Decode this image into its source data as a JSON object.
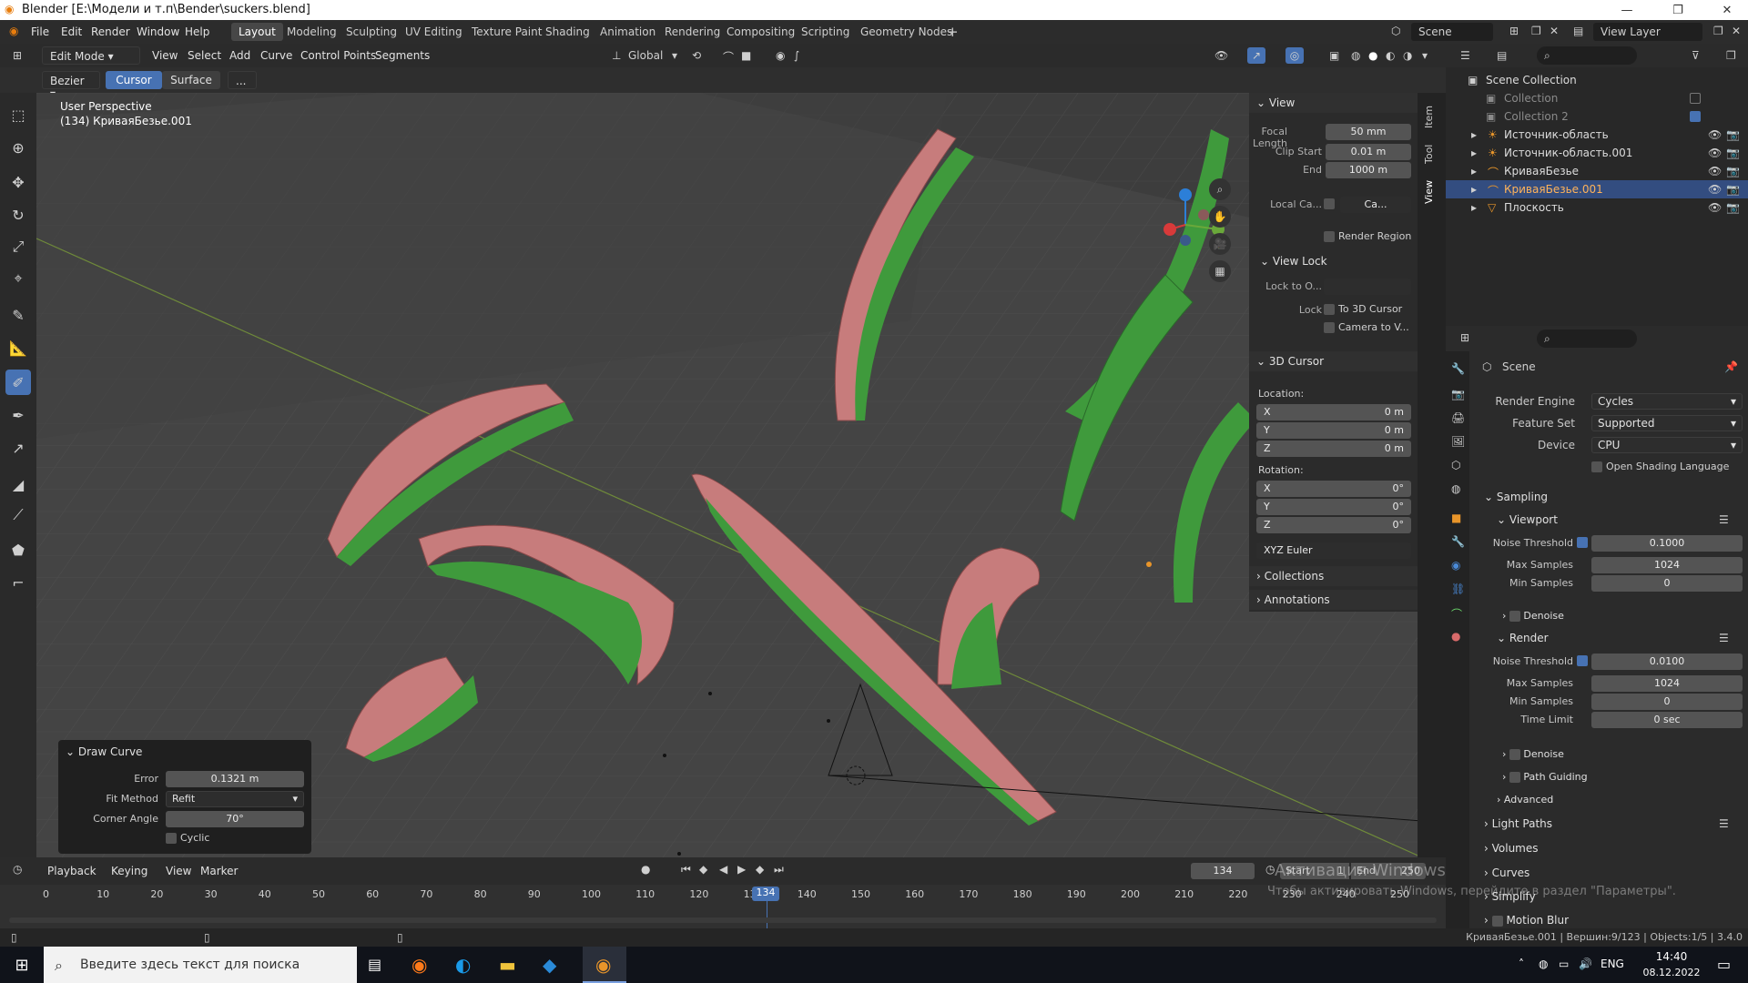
{
  "window": {
    "title": "Blender [E:\\Модели и т.п\\Bender\\suckers.blend]"
  },
  "menubar": {
    "items": [
      "File",
      "Edit",
      "Render",
      "Window",
      "Help"
    ]
  },
  "workspaces": [
    "Layout",
    "Modeling",
    "Sculpting",
    "UV Editing",
    "Texture Paint",
    "Shading",
    "Animation",
    "Rendering",
    "Compositing",
    "Scripting",
    "Geometry Nodes"
  ],
  "scene": {
    "name": "Scene",
    "view_layer": "View Layer"
  },
  "header": {
    "mode": "Edit Mode",
    "menus": [
      "View",
      "Select",
      "Add",
      "Curve",
      "Control Points",
      "Segments"
    ],
    "orientation": "Global"
  },
  "toolsettings": {
    "curve_type": "Bezier",
    "depth_cursor": "Cursor",
    "depth_surface": "Surface",
    "more": "..."
  },
  "viewport": {
    "perspective": "User Perspective",
    "object_info": "(134) КриваяБезье.001"
  },
  "npanel": {
    "tabs": [
      "Item",
      "Tool",
      "View"
    ],
    "view_header": "View",
    "focal_label": "Focal Length",
    "focal": "50 mm",
    "clip_start_label": "Clip Start",
    "clip_start": "0.01 m",
    "end_label": "End",
    "end": "1000 m",
    "local_camera_label": "Local Ca...",
    "local_camera_field": "Ca...",
    "render_region": "Render Region",
    "view_lock_header": "View Lock",
    "lock_to_label": "Lock to O...",
    "lock_label": "Lock",
    "to_3d_cursor": "To 3D Cursor",
    "camera_to_view": "Camera to V...",
    "cursor_header": "3D Cursor",
    "location_label": "Location:",
    "rotation_label": "Rotation:",
    "loc": [
      {
        "axis": "X",
        "value": "0 m"
      },
      {
        "axis": "Y",
        "value": "0 m"
      },
      {
        "axis": "Z",
        "value": "0 m"
      }
    ],
    "rot": [
      {
        "axis": "X",
        "value": "0°"
      },
      {
        "axis": "Y",
        "value": "0°"
      },
      {
        "axis": "Z",
        "value": "0°"
      }
    ],
    "rot_mode": "XYZ Euler",
    "collections": "Collections",
    "annotations": "Annotations"
  },
  "draw_curve": {
    "title": "Draw Curve",
    "error_label": "Error",
    "error": "0.1321 m",
    "fit_label": "Fit Method",
    "fit": "Refit",
    "corner_label": "Corner Angle",
    "corner": "70°",
    "cyclic": "Cyclic"
  },
  "outliner": {
    "root": "Scene Collection",
    "rows": [
      "Collection",
      "Collection 2",
      "Источник-область",
      "Источник-область.001",
      "КриваяБезье",
      "КриваяБезье.001",
      "Плоскость"
    ]
  },
  "properties": {
    "scene": "Scene",
    "render_engine_label": "Render Engine",
    "render_engine": "Cycles",
    "feature_set_label": "Feature Set",
    "feature_set": "Supported",
    "device_label": "Device",
    "device": "CPU",
    "osl": "Open Shading Language",
    "sampling": "Sampling",
    "viewport": "Viewport",
    "noise_label": "Noise Threshold",
    "vp_noise": "0.1000",
    "max_label": "Max Samples",
    "vp_max": "1024",
    "min_label": "Min Samples",
    "vp_min": "0",
    "denoise": "Denoise",
    "render": "Render",
    "r_noise": "0.0100",
    "r_max": "1024",
    "r_min": "0",
    "time_label": "Time Limit",
    "time": "0 sec",
    "path_guiding": "Path Guiding",
    "advanced": "Advanced",
    "light_paths": "Light Paths",
    "volumes": "Volumes",
    "curves": "Curves",
    "simplify": "Simplify",
    "motion_blur": "Motion Blur"
  },
  "timeline": {
    "menus": [
      "Playback",
      "Keying",
      "View",
      "Marker"
    ],
    "current": "134",
    "start_label": "Start",
    "start": "1",
    "end_label": "End",
    "end": "250",
    "ticks": [
      "0",
      "10",
      "20",
      "30",
      "40",
      "50",
      "60",
      "70",
      "80",
      "90",
      "100",
      "110",
      "120",
      "130",
      "140",
      "150",
      "160",
      "170",
      "180",
      "190",
      "200",
      "210",
      "220",
      "230",
      "240",
      "250"
    ]
  },
  "watermark": {
    "line1": "Активация Windows",
    "line2": "Чтобы активировать Windows, перейдите в раздел \"Параметры\"."
  },
  "status": {
    "text": "КриваяБезье.001 | Вершин:9/123 | Objects:1/5 | 3.4.0"
  },
  "taskbar": {
    "search": "Введите здесь текст для поиска",
    "lang": "ENG",
    "time": "14:40",
    "date": "08.12.2022"
  }
}
